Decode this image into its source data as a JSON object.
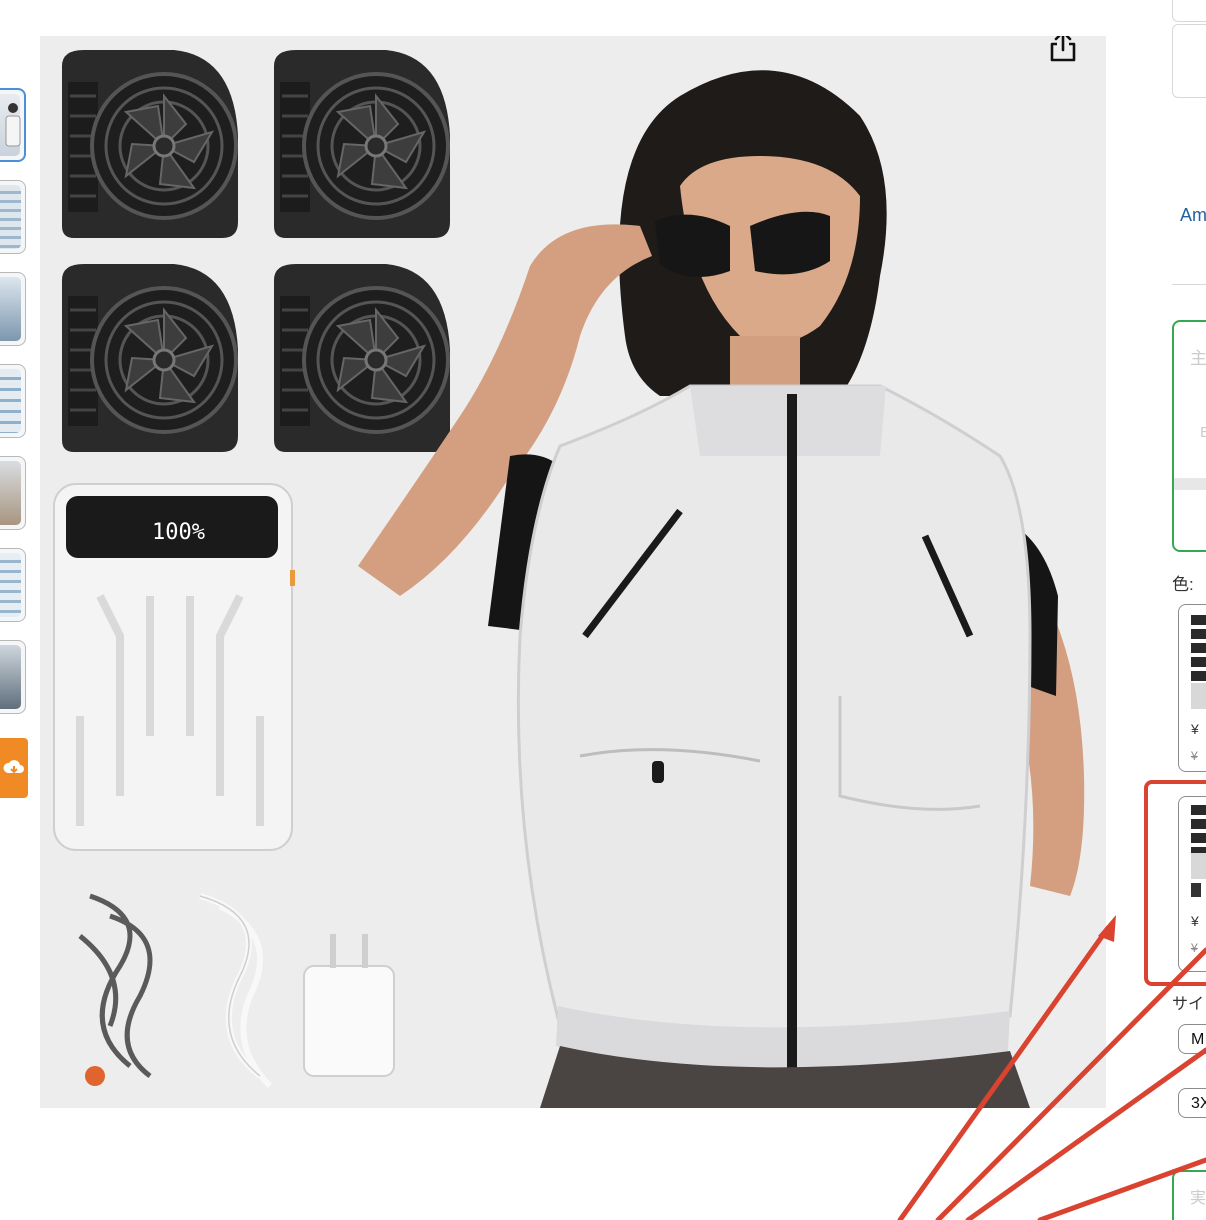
{
  "product_image": {
    "power_bank_display": "100%",
    "share_icon": "share-icon"
  },
  "thumbnails": {
    "count": 7,
    "selected_index": 0,
    "video_icon": "cloud-video-icon"
  },
  "right_panel": {
    "amazon_link": "Am",
    "color_label": "色:",
    "green_box_text_1": "主",
    "green_box_text_2": "E",
    "swatches": [
      {
        "price": "¥",
        "strike": "¥"
      },
      {
        "price": "¥",
        "strike": "¥"
      }
    ],
    "size_label": "サイ",
    "size_options": [
      "M",
      "3X"
    ],
    "bottom_text": "実"
  },
  "colors": {
    "accent_green": "#36a852",
    "link_blue": "#2162a1",
    "annotation_red": "#d9432f",
    "thumb_selected": "#4b8fd6"
  }
}
